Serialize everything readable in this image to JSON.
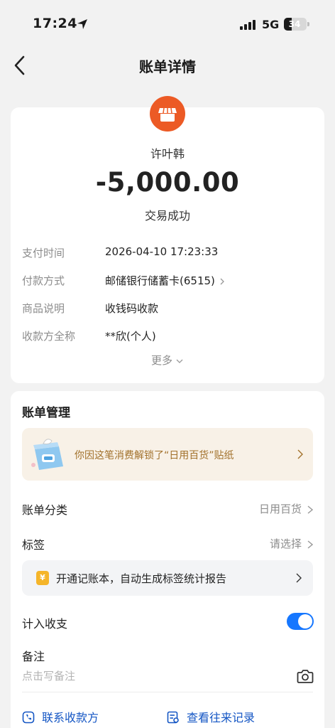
{
  "status_bar": {
    "time": "17:24",
    "network": "5G",
    "battery": "34",
    "battery_level": 0.34
  },
  "header": {
    "title": "账单详情"
  },
  "summary": {
    "merchant_name": "许叶韩",
    "amount": "-5,000.00",
    "status": "交易成功",
    "icon": "shop-icon",
    "icon_color": "#ec5a25"
  },
  "details": [
    {
      "label": "支付时间",
      "value": "2026-04-10 17:23:33"
    },
    {
      "label": "付款方式",
      "value": "邮储银行储蓄卡(6515)"
    },
    {
      "label": "商品说明",
      "value": "收钱码收款"
    },
    {
      "label": "收款方全称",
      "value": "**欣(个人)"
    }
  ],
  "more_label": "更多",
  "management": {
    "title": "账单管理",
    "sticker_text": "你因这笔消费解锁了“日用百货”贴纸",
    "category_label": "账单分类",
    "category_value": "日用百货",
    "tag_label": "标签",
    "tag_value": "请选择",
    "ledger_icon_text": "¥",
    "ledger_text": "开通记账本，自动生成标签统计报告",
    "include_label": "计入收支",
    "include_enabled": true,
    "note_label": "备注",
    "note_placeholder": "点击写备注"
  },
  "footer": {
    "contact_label": "联系收款方",
    "history_label": "查看往来记录"
  },
  "colors": {
    "accent_blue": "#1677ff",
    "link_blue": "#1456c4",
    "banner_text": "#a2712b"
  }
}
